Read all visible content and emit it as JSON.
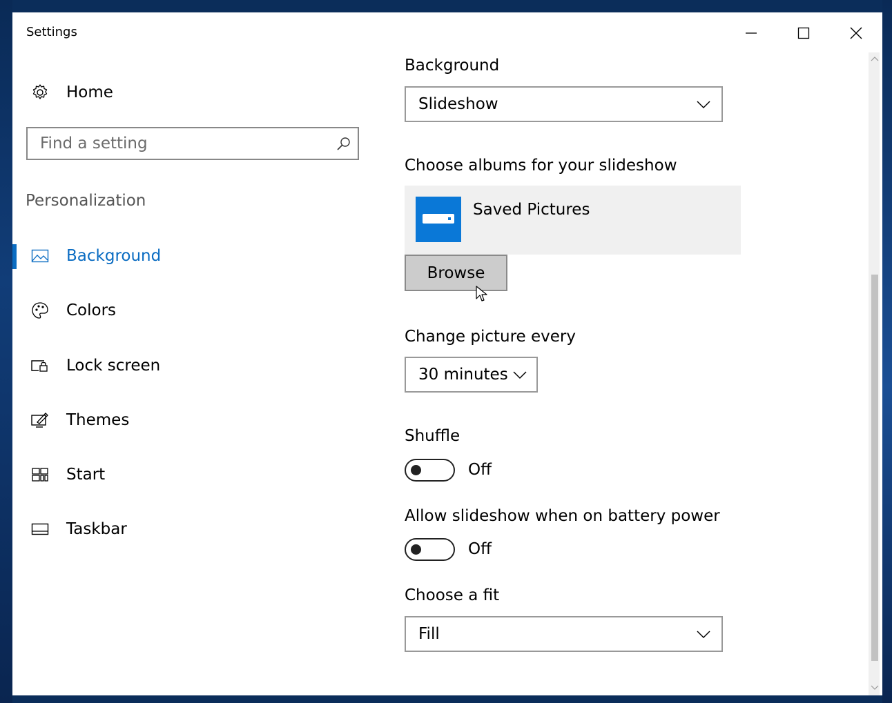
{
  "window": {
    "title": "Settings",
    "minimize_icon": "minimize-icon",
    "maximize_icon": "maximize-icon",
    "close_icon": "close-icon"
  },
  "sidebar": {
    "home_label": "Home",
    "search_placeholder": "Find a setting",
    "section_title": "Personalization",
    "items": [
      {
        "label": "Background",
        "icon": "picture-icon",
        "active": true
      },
      {
        "label": "Colors",
        "icon": "palette-icon",
        "active": false
      },
      {
        "label": "Lock screen",
        "icon": "lock-screen-icon",
        "active": false
      },
      {
        "label": "Themes",
        "icon": "themes-icon",
        "active": false
      },
      {
        "label": "Start",
        "icon": "start-icon",
        "active": false
      },
      {
        "label": "Taskbar",
        "icon": "taskbar-icon",
        "active": false
      }
    ],
    "accent_color": "#0a6cc2"
  },
  "content": {
    "background": {
      "label": "Background",
      "value": "Slideshow"
    },
    "albums": {
      "label": "Choose albums for your slideshow",
      "album_name": "Saved Pictures",
      "browse_label": "Browse"
    },
    "interval": {
      "label": "Change picture every",
      "value": "30 minutes"
    },
    "shuffle": {
      "label": "Shuffle",
      "state": "Off"
    },
    "battery": {
      "label": "Allow slideshow when on battery power",
      "state": "Off"
    },
    "fit": {
      "label": "Choose a fit",
      "value": "Fill"
    }
  }
}
